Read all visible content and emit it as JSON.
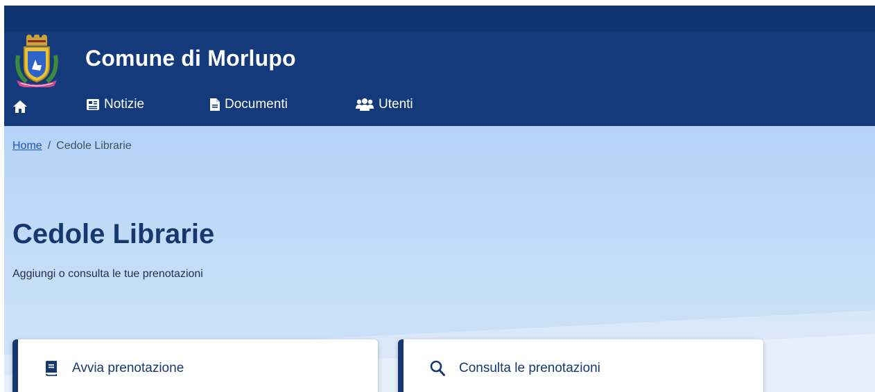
{
  "header": {
    "site_title": "Comune di Morlupo"
  },
  "nav": {
    "home_icon": "home-icon",
    "items": [
      {
        "label": "Notizie",
        "icon": "newspaper-icon"
      },
      {
        "label": "Documenti",
        "icon": "document-icon"
      },
      {
        "label": "Utenti",
        "icon": "users-icon"
      }
    ]
  },
  "breadcrumb": {
    "home": "Home",
    "separator": "/",
    "current": "Cedole Librarie"
  },
  "page": {
    "title": "Cedole Librarie",
    "subtitle": "Aggiungi o consulta le tue prenotazioni"
  },
  "cards": [
    {
      "label": "Avvia prenotazione",
      "icon": "book-icon"
    },
    {
      "label": "Consulta le prenotazioni",
      "icon": "search-icon"
    }
  ],
  "colors": {
    "header_bg": "#143a7b",
    "hero_bg": "#b5d3f7",
    "title": "#17386f",
    "link": "#1a55b8"
  }
}
